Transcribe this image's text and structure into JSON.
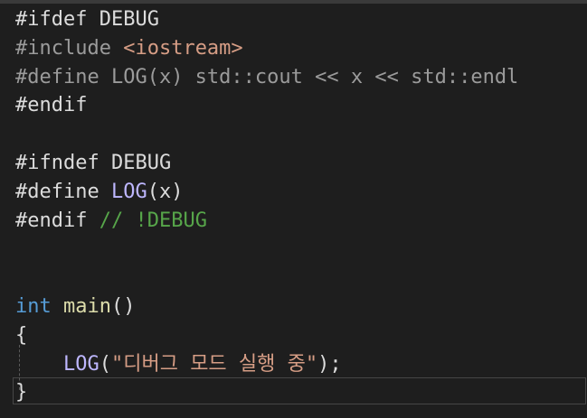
{
  "colors": {
    "background": "#1e1e1e",
    "directive": "#9b9b9b",
    "macro": "#beb7ff",
    "comment": "#57a64a",
    "keyword": "#569cd6",
    "function": "#dcdcaa",
    "string": "#d69d85",
    "text": "#dcdcdc"
  },
  "code": {
    "l1": {
      "directive": "#ifdef",
      "name": "DEBUG"
    },
    "l2": {
      "directive": "#include",
      "path": "<iostream>"
    },
    "l3": {
      "directive": "#define",
      "body": "LOG(x) std::cout << x << std::endl"
    },
    "l4": {
      "directive": "#endif"
    },
    "l6": {
      "directive": "#ifndef",
      "name": "DEBUG"
    },
    "l7": {
      "directive": "#define",
      "macro": "LOG",
      "params": "(x)"
    },
    "l8": {
      "directive": "#endif",
      "comment": "// !DEBUG"
    },
    "l11": {
      "type": "int",
      "func": "main",
      "parens": "()"
    },
    "l12": {
      "brace": "{"
    },
    "l13": {
      "indent": "    ",
      "macro": "LOG",
      "open": "(",
      "string": "\"디버그 모드 실행 중\"",
      "close": ");"
    },
    "l14": {
      "brace": "}"
    }
  }
}
